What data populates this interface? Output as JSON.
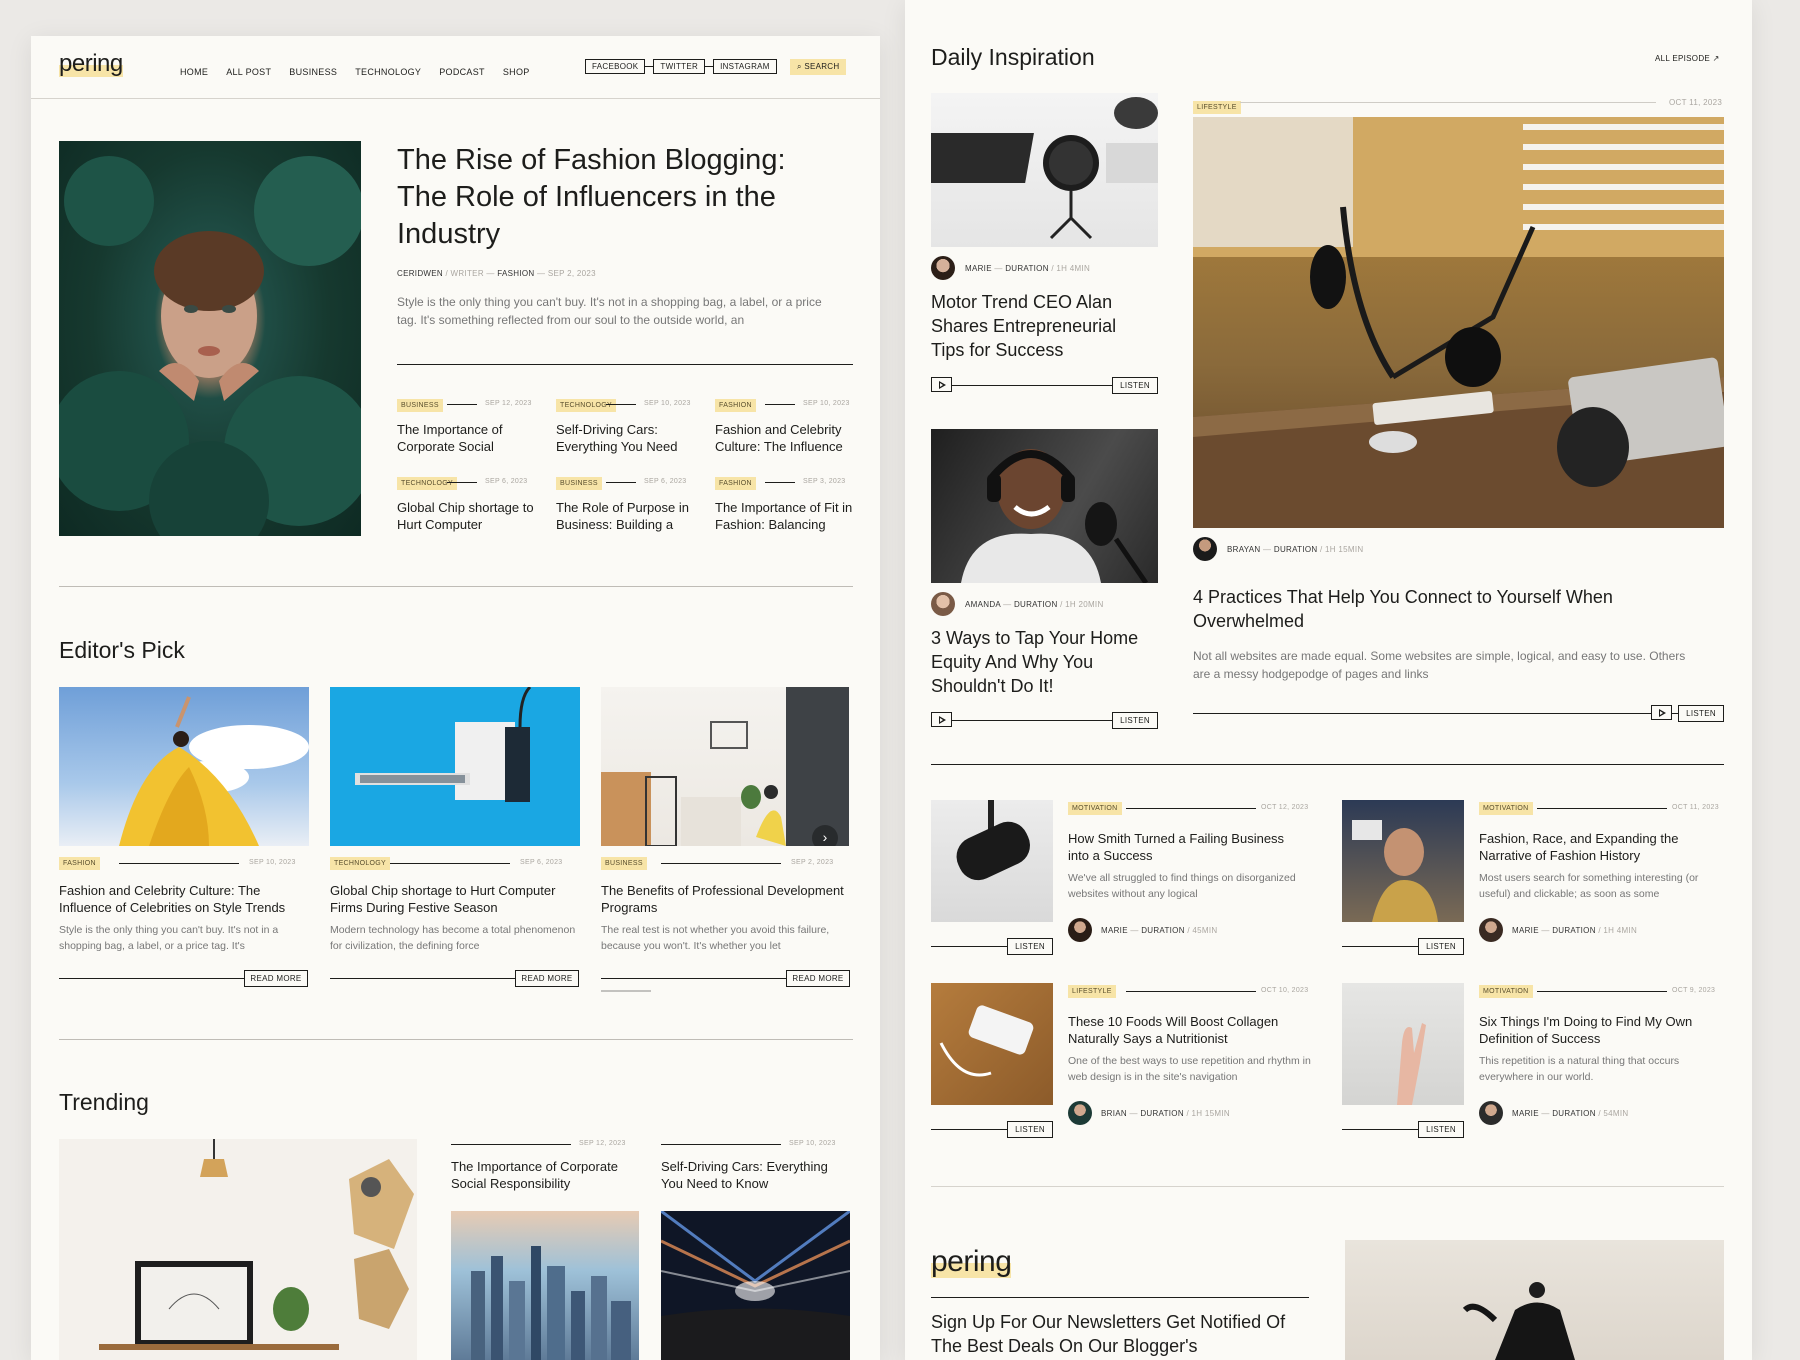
{
  "left": {
    "logo": "pering",
    "nav": [
      "HOME",
      "ALL POST",
      "BUSINESS",
      "TECHNOLOGY",
      "PODCAST",
      "SHOP"
    ],
    "social": [
      "FACEBOOK",
      "TWITTER",
      "INSTAGRAM"
    ],
    "search_label": "SEARCH",
    "hero": {
      "title": "The Rise of Fashion Blogging: The Role of Influencers in the Industry",
      "author": "CERIDWEN",
      "role": "/ WRITER",
      "category": "FASHION",
      "date": "SEP 2, 2023",
      "excerpt": "Style is the only thing you can't buy. It's not in a shopping bag, a label, or a price tag. It's something reflected from our soul to the outside world, an"
    },
    "mini_posts": [
      {
        "tag": "BUSINESS",
        "date": "SEP 12, 2023",
        "title": "The Importance of Corporate Social"
      },
      {
        "tag": "TECHNOLOGY",
        "date": "SEP 10, 2023",
        "title": "Self-Driving Cars: Everything You Need"
      },
      {
        "tag": "FASHION",
        "date": "SEP 10, 2023",
        "title": "Fashion and Celebrity Culture: The Influence"
      },
      {
        "tag": "TECHNOLOGY",
        "date": "SEP 6, 2023",
        "title": "Global Chip shortage to Hurt Computer"
      },
      {
        "tag": "BUSINESS",
        "date": "SEP 6, 2023",
        "title": "The Role of Purpose in Business: Building a"
      },
      {
        "tag": "FASHION",
        "date": "SEP 3, 2023",
        "title": "The Importance of Fit in Fashion: Balancing"
      }
    ],
    "editors_pick": {
      "heading": "Editor's Pick",
      "read_more": "READ MORE",
      "cards": [
        {
          "tag": "FASHION",
          "date": "SEP 10, 2023",
          "title": "Fashion and Celebrity Culture: The Influence of Celebrities on Style Trends",
          "excerpt": "Style is the only thing you can't buy. It's not in a shopping bag, a label, or a price tag. It's"
        },
        {
          "tag": "TECHNOLOGY",
          "date": "SEP 6, 2023",
          "title": "Global Chip shortage to Hurt Computer Firms During Festive Season",
          "excerpt": "Modern technology has become a total phenomenon for civilization, the defining force"
        },
        {
          "tag": "BUSINESS",
          "date": "SEP 2, 2023",
          "title": "The Benefits of Professional Development Programs",
          "excerpt": "The real test is not whether you avoid this failure, because you won't. It's whether you let"
        }
      ]
    },
    "trending": {
      "heading": "Trending",
      "items": [
        {
          "date": "SEP 12, 2023",
          "title": "The Importance of Corporate Social Responsibility"
        },
        {
          "date": "SEP 10, 2023",
          "title": "Self-Driving Cars: Everything You Need to Know"
        }
      ]
    }
  },
  "right": {
    "heading": "Daily Inspiration",
    "all_episode": "ALL EPISODE",
    "listen": "LISTEN",
    "duration_label": "DURATION",
    "podcasts": [
      {
        "author": "MARIE",
        "duration": "/ 1H 4MIN",
        "title": "Motor Trend CEO Alan Shares Entrepreneurial Tips for Success"
      },
      {
        "author": "AMANDA",
        "duration": "/ 1H 20MIN",
        "title": "3 Ways to Tap Your Home Equity And Why You Shouldn't Do It!"
      }
    ],
    "feature": {
      "tag": "LIFESTYLE",
      "date": "OCT 11, 2023",
      "author": "BRAYAN",
      "duration": "/ 1H 15MIN",
      "title": "4 Practices That Help You Connect to Yourself When Overwhelmed",
      "excerpt": "Not all websites are made equal. Some websites are simple, logical, and easy to use. Others are a messy hodgepodge of pages and links"
    },
    "episodes": [
      {
        "tag": "MOTIVATION",
        "date": "OCT 12, 2023",
        "title": "How Smith Turned a Failing Business into a Success",
        "excerpt": "We've all struggled to find things on disorganized websites without any logical",
        "author": "MARIE",
        "duration": "/ 45MIN"
      },
      {
        "tag": "MOTIVATION",
        "date": "OCT 11, 2023",
        "title": "Fashion, Race, and Expanding the Narrative of Fashion History",
        "excerpt": "Most users search for something interesting (or useful) and clickable; as soon as some",
        "author": "MARIE",
        "duration": "/ 1H 4MIN"
      },
      {
        "tag": "LIFESTYLE",
        "date": "OCT 10, 2023",
        "title": "These 10 Foods Will Boost Collagen Naturally Says a Nutritionist",
        "excerpt": "One of the best ways to use repetition and rhythm in web design is in the site's navigation",
        "author": "BRIAN",
        "duration": "/ 1H 15MIN"
      },
      {
        "tag": "MOTIVATION",
        "date": "OCT 9, 2023",
        "title": "Six Things I'm Doing to Find My Own Definition of Success",
        "excerpt": "This repetition is a natural thing that occurs everywhere in our world.",
        "author": "MARIE",
        "duration": "/ 54MIN"
      }
    ],
    "newsletter": {
      "logo": "pering",
      "title": "Sign Up For Our Newsletters Get Notified Of The Best Deals On Our Blogger's"
    }
  },
  "colors": {
    "accent": "#f7e4a7",
    "background": "#fbfaf6",
    "text": "#1d1d1b"
  }
}
